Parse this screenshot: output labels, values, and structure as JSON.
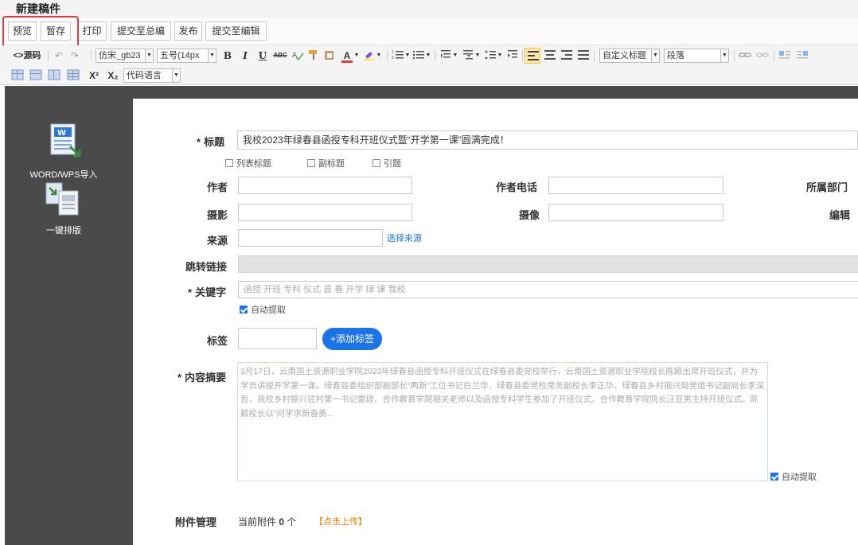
{
  "window": {
    "title": "新建稿件"
  },
  "actions": {
    "preview": "预览",
    "save_draft": "暂存",
    "print": "打印",
    "submit_chief": "提交至总编",
    "publish": "发布",
    "submit_editor": "提交至编辑"
  },
  "toolbar": {
    "source": "<>源码",
    "font_family": "仿宋_gb23",
    "font_size": "五号(14px",
    "bold": "B",
    "italic": "I",
    "underline": "U",
    "strike": "ABC",
    "custom_heading": "自定义标题",
    "paragraph": "段落",
    "superscript": "X²",
    "subscript": "X₂",
    "code_lang": "代码语言"
  },
  "left_tools": [
    {
      "label": "WORD/WPS导入",
      "icon": "word-import-icon"
    },
    {
      "label": "一键排版",
      "icon": "one-click-format-icon"
    }
  ],
  "form": {
    "title_label": "标题",
    "title_value": "我校2023年绿春县函授专科开班仪式暨“开学第一课”圆满完成！",
    "checkbox_list_title": "列表标题",
    "checkbox_sub_title": "副标题",
    "checkbox_lead_title": "引题",
    "author_label": "作者",
    "author_phone_label": "作者电话",
    "dept_label": "所属部门",
    "photo_label": "摄影",
    "video_label": "摄像",
    "editor_label": "编辑",
    "source_label": "来源",
    "choose_source": "选择来源",
    "redirect_label": "跳转链接",
    "keywords_label": "关键字",
    "keywords_value": "函授 开班 专科 仪式 县 春 开学 绿 课 我校",
    "auto_extract": "自动提取",
    "tags_label": "标签",
    "add_tag_button": "+添加标签",
    "summary_label": "内容摘要",
    "summary_text": "3月17日，云南国土资源职业学院2023年绿春县函授专科开班仪式在绿春县委党校举行，云南国土资源职业学院校长陈颖出席开班仪式，并为学员讲授开学第一课。绿春县委组织部副部长“两新”工位书记白兰华、绿春县委党校常务副校长李正华、绿春县乡村振兴局党组书记副局长李深哲、我校乡村振兴驻村第一书记雷琼、合作教育学院相关老师以及函授专科学生参加了开班仪式。合作教育学院院长汪亚男主持开班仪式。陈颖校长以“问学求新奋勇...",
    "summary_auto": "自动提取",
    "attachments_label": "附件管理",
    "attachments_prefix": "当前附件",
    "attachments_count": "0",
    "attachments_unit": "个",
    "upload_link": "【点击上传】"
  },
  "colors": {
    "accent_blue": "#1a73e8",
    "highlight_red": "#e53935",
    "upload_orange": "#f57c00",
    "panel_dark": "#4a4a4a"
  }
}
